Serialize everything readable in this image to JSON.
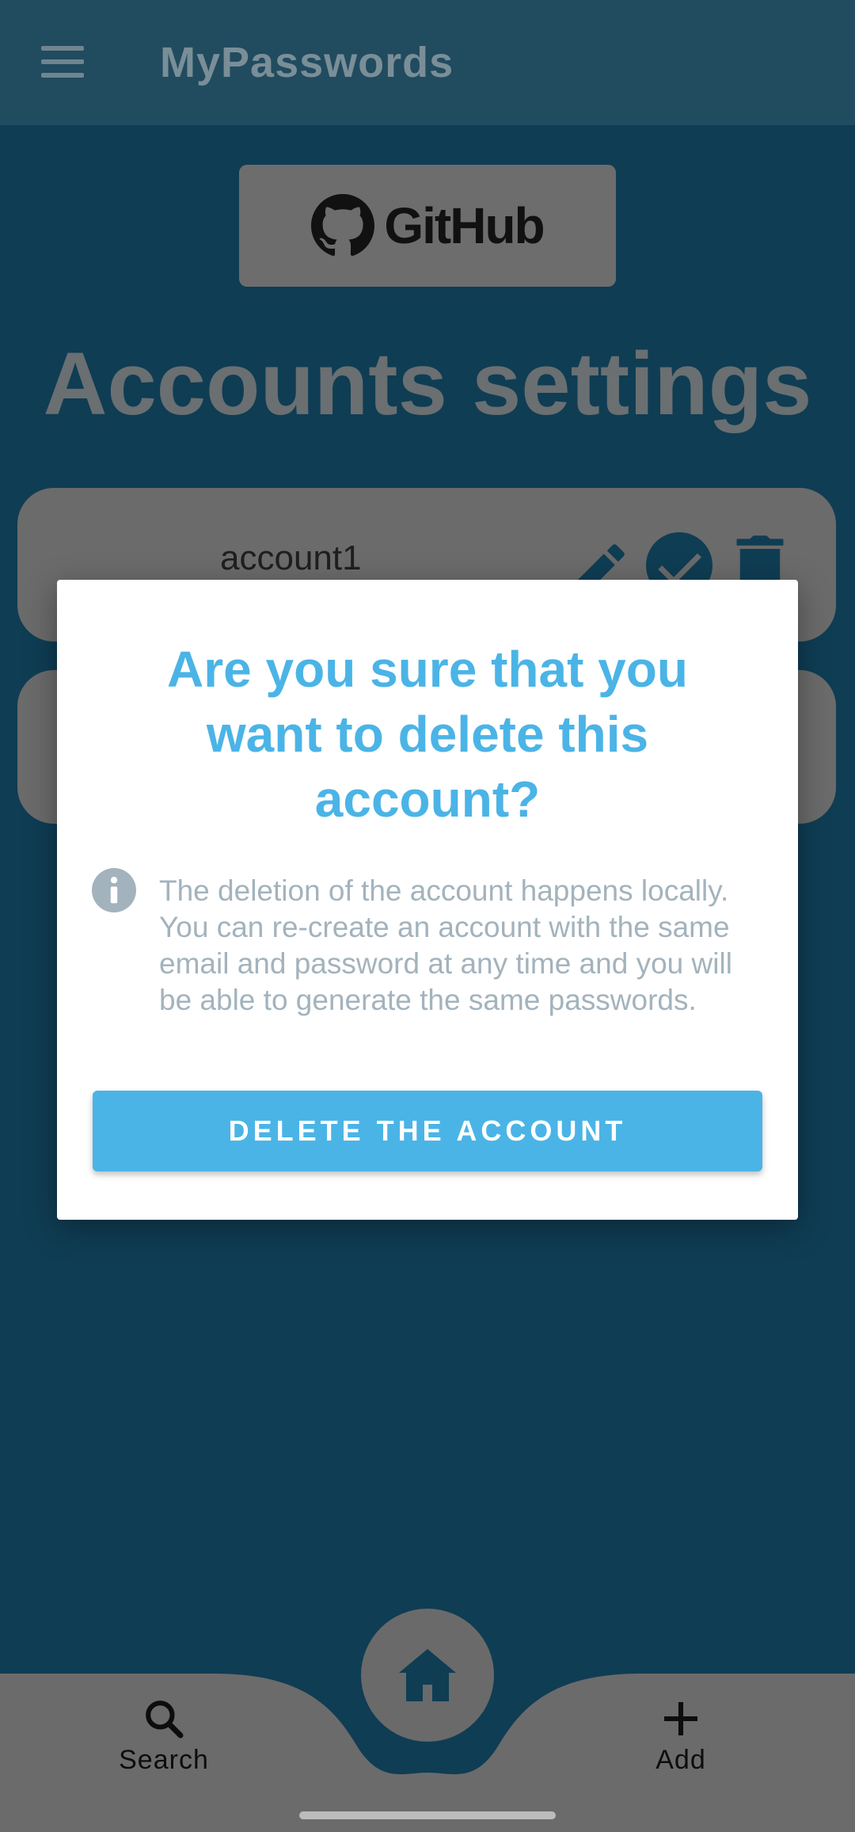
{
  "app": {
    "title": "MyPasswords",
    "menu_icon": "hamburger-menu-icon"
  },
  "github": {
    "label": "GitHub",
    "icon": "github-logo-icon"
  },
  "page": {
    "heading": "Accounts settings"
  },
  "accounts": [
    {
      "name": "account1",
      "icons": [
        "edit-pencil-icon",
        "check-circle-icon",
        "trash-icon"
      ]
    },
    {
      "name": ""
    }
  ],
  "dialog": {
    "title": "Are you sure that you want to delete this account?",
    "info_icon": "info-circle-icon",
    "body": "The deletion of the account happens locally. You can re-create an account with the same email and password at any time and you will be able to generate the same passwords.",
    "button_label": "DELETE THE ACCOUNT"
  },
  "bottom_nav": {
    "search_label": "Search",
    "search_icon": "search-icon",
    "add_label": "Add",
    "add_icon": "plus-icon",
    "home_icon": "home-icon"
  },
  "colors": {
    "accent": "#4bb4e6",
    "background": "#0f3d54",
    "dialog_text": "#a3b3bd"
  }
}
